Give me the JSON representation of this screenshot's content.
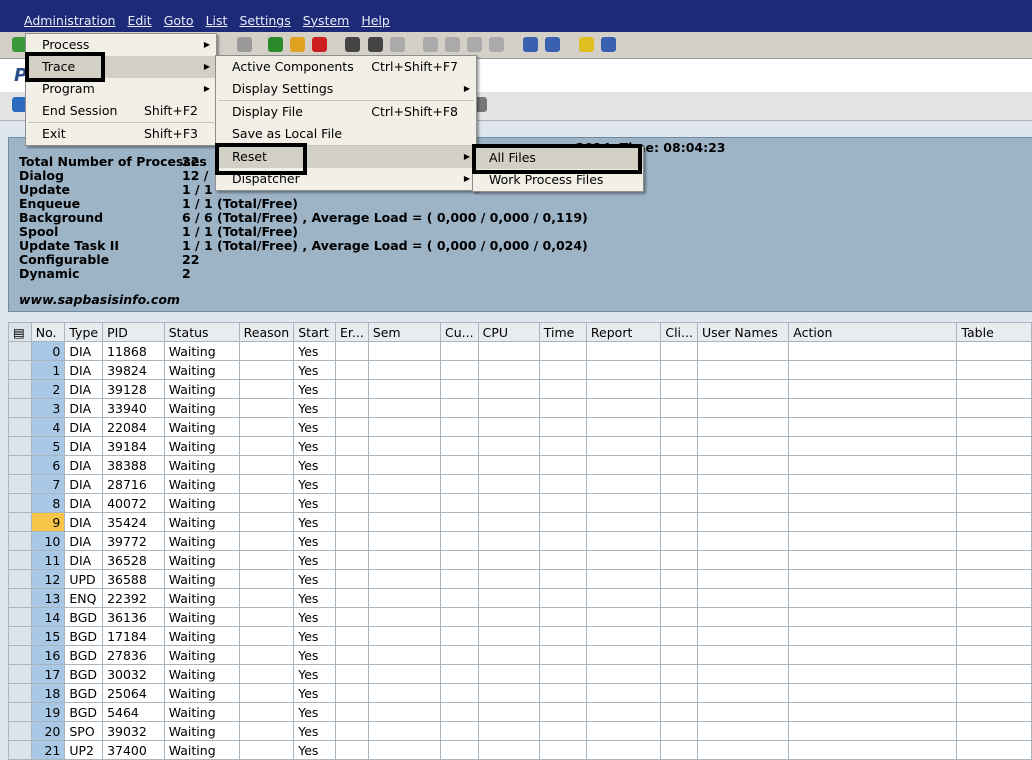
{
  "menubar": [
    "Administration",
    "Edit",
    "Goto",
    "List",
    "Settings",
    "System",
    "Help"
  ],
  "admin_menu": [
    {
      "label": "Process",
      "arrow": true
    },
    {
      "label": "Trace",
      "arrow": true
    },
    {
      "label": "Program",
      "arrow": true
    },
    {
      "label": "End Session",
      "shortcut": "Shift+F2"
    },
    {
      "label": "Exit",
      "shortcut": "Shift+F3"
    }
  ],
  "trace_menu": [
    {
      "label": "Active Components",
      "shortcut": "Ctrl+Shift+F7"
    },
    {
      "label": "Display Settings",
      "arrow": true
    },
    {
      "label": "Display File",
      "shortcut": "Ctrl+Shift+F8"
    },
    {
      "label": "Save as Local File"
    },
    {
      "label": "Reset",
      "arrow": true
    },
    {
      "label": "Dispatcher",
      "arrow": true
    }
  ],
  "reset_menu": [
    {
      "label": "All Files"
    },
    {
      "label": "Work Process Files"
    }
  ],
  "title_fragment": "P",
  "info": {
    "date_time": ".2014, Time: 08:04:23",
    "rows": [
      [
        "Total Number of Processes",
        "22"
      ],
      [
        "Dialog",
        "12 /"
      ],
      [
        "Update",
        "1 / 1"
      ],
      [
        "Enqueue",
        "1 / 1 (Total/Free)"
      ],
      [
        "Background",
        "6 / 6 (Total/Free) , Average Load = ( 0,000 / 0,000 / 0,119)"
      ],
      [
        "Spool",
        "1 / 1 (Total/Free)"
      ],
      [
        "Update Task II",
        "1 / 1 (Total/Free) , Average Load = ( 0,000 / 0,000 / 0,024)"
      ],
      [
        "Configurable",
        "22"
      ],
      [
        "Dynamic",
        "2"
      ]
    ],
    "website": "www.sapbasisinfo.com"
  },
  "table": {
    "columns": [
      "No.",
      "Type",
      "PID",
      "Status",
      "Reason",
      "Start",
      "Er...",
      "Sem",
      "Cu...",
      "CPU",
      "Time",
      "Report",
      "Cli...",
      "User Names",
      "Action",
      "Table"
    ],
    "rows": [
      [
        0,
        "DIA",
        "11868"
      ],
      [
        1,
        "DIA",
        "39824"
      ],
      [
        2,
        "DIA",
        "39128"
      ],
      [
        3,
        "DIA",
        "33940"
      ],
      [
        4,
        "DIA",
        "22084"
      ],
      [
        5,
        "DIA",
        "39184"
      ],
      [
        6,
        "DIA",
        "38388"
      ],
      [
        7,
        "DIA",
        "28716"
      ],
      [
        8,
        "DIA",
        "40072"
      ],
      [
        9,
        "DIA",
        "35424"
      ],
      [
        10,
        "DIA",
        "39772"
      ],
      [
        11,
        "DIA",
        "36528"
      ],
      [
        12,
        "UPD",
        "36588"
      ],
      [
        13,
        "ENQ",
        "22392"
      ],
      [
        14,
        "BGD",
        "36136"
      ],
      [
        15,
        "BGD",
        "17184"
      ],
      [
        16,
        "BGD",
        "27836"
      ],
      [
        17,
        "BGD",
        "30032"
      ],
      [
        18,
        "BGD",
        "25064"
      ],
      [
        19,
        "BGD",
        "5464"
      ],
      [
        20,
        "SPO",
        "39032"
      ],
      [
        21,
        "UP2",
        "37400"
      ]
    ],
    "status": "Waiting",
    "start": "Yes",
    "highlighted_row": 9
  }
}
